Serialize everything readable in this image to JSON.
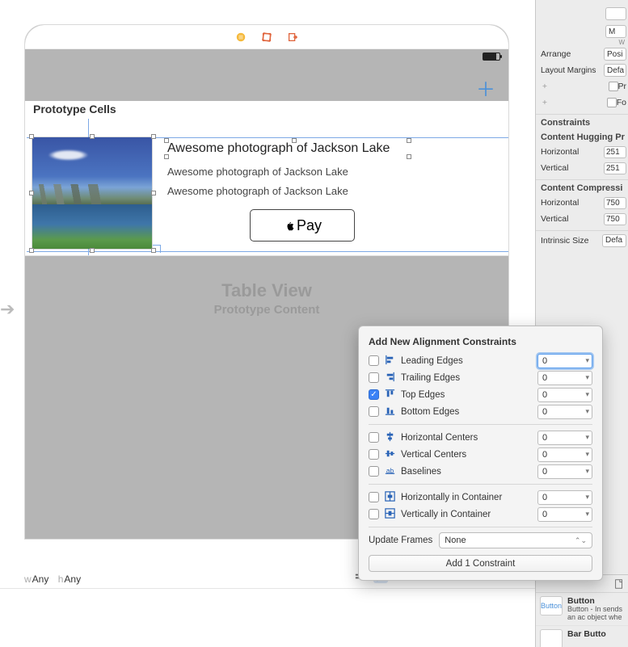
{
  "device": {
    "status": {
      "battery_pct": 80
    }
  },
  "proto_header": "Prototype Cells",
  "cell": {
    "img_alt": "Jackson Lake landscape",
    "title": "Awesome photograph of Jackson Lake",
    "subtitle1": "Awesome photograph of Jackson Lake",
    "subtitle2": "Awesome photograph of Jackson Lake",
    "pay_label": "Pay"
  },
  "tableview": {
    "title": "Table View",
    "subtitle": "Prototype Content"
  },
  "size_class": {
    "w_label": "w",
    "w_value": "Any",
    "h_label": "h",
    "h_value": "Any"
  },
  "inspector": {
    "top_fields": [
      {
        "label": "",
        "value": ""
      },
      {
        "label": "",
        "value": "M"
      }
    ],
    "sublabel_w": "W",
    "arrange": {
      "label": "Arrange",
      "value": "Posi"
    },
    "layout_margins": {
      "label": "Layout Margins",
      "value": "Defa"
    },
    "preserve": "Pr",
    "followreadable": "Fo",
    "constraints_head": "Constraints",
    "hugging_head": "Content Hugging Pr",
    "hugging_h_label": "Horizontal",
    "hugging_h": "251",
    "hugging_v_label": "Vertical",
    "hugging_v": "251",
    "compress_head": "Content Compressi",
    "compress_h_label": "Horizontal",
    "compress_h": "750",
    "compress_v_label": "Vertical",
    "compress_v": "750",
    "intrinsic_label": "Intrinsic Size",
    "intrinsic_value": "Defa"
  },
  "library": {
    "item1": {
      "title": "Button",
      "desc": "Button - In sends an ac object whe",
      "swatch": "Button"
    },
    "item2": {
      "title": "Bar Butto"
    }
  },
  "popover": {
    "title": "Add New Alignment Constraints",
    "rows": [
      {
        "key": "leading",
        "label": "Leading Edges",
        "checked": false,
        "value": "0",
        "focused": true
      },
      {
        "key": "trailing",
        "label": "Trailing Edges",
        "checked": false,
        "value": "0"
      },
      {
        "key": "top",
        "label": "Top Edges",
        "checked": true,
        "value": "0"
      },
      {
        "key": "bottom",
        "label": "Bottom Edges",
        "checked": false,
        "value": "0"
      }
    ],
    "rows2": [
      {
        "key": "hcenters",
        "label": "Horizontal Centers",
        "checked": false,
        "value": "0"
      },
      {
        "key": "vcenters",
        "label": "Vertical Centers",
        "checked": false,
        "value": "0"
      },
      {
        "key": "baselines",
        "label": "Baselines",
        "checked": false,
        "value": "0"
      }
    ],
    "rows3": [
      {
        "key": "hcontainer",
        "label": "Horizontally in Container",
        "checked": false,
        "value": "0"
      },
      {
        "key": "vcontainer",
        "label": "Vertically in Container",
        "checked": false,
        "value": "0"
      }
    ],
    "update_frames_label": "Update Frames",
    "update_frames_value": "None",
    "add_button": "Add 1 Constraint"
  }
}
